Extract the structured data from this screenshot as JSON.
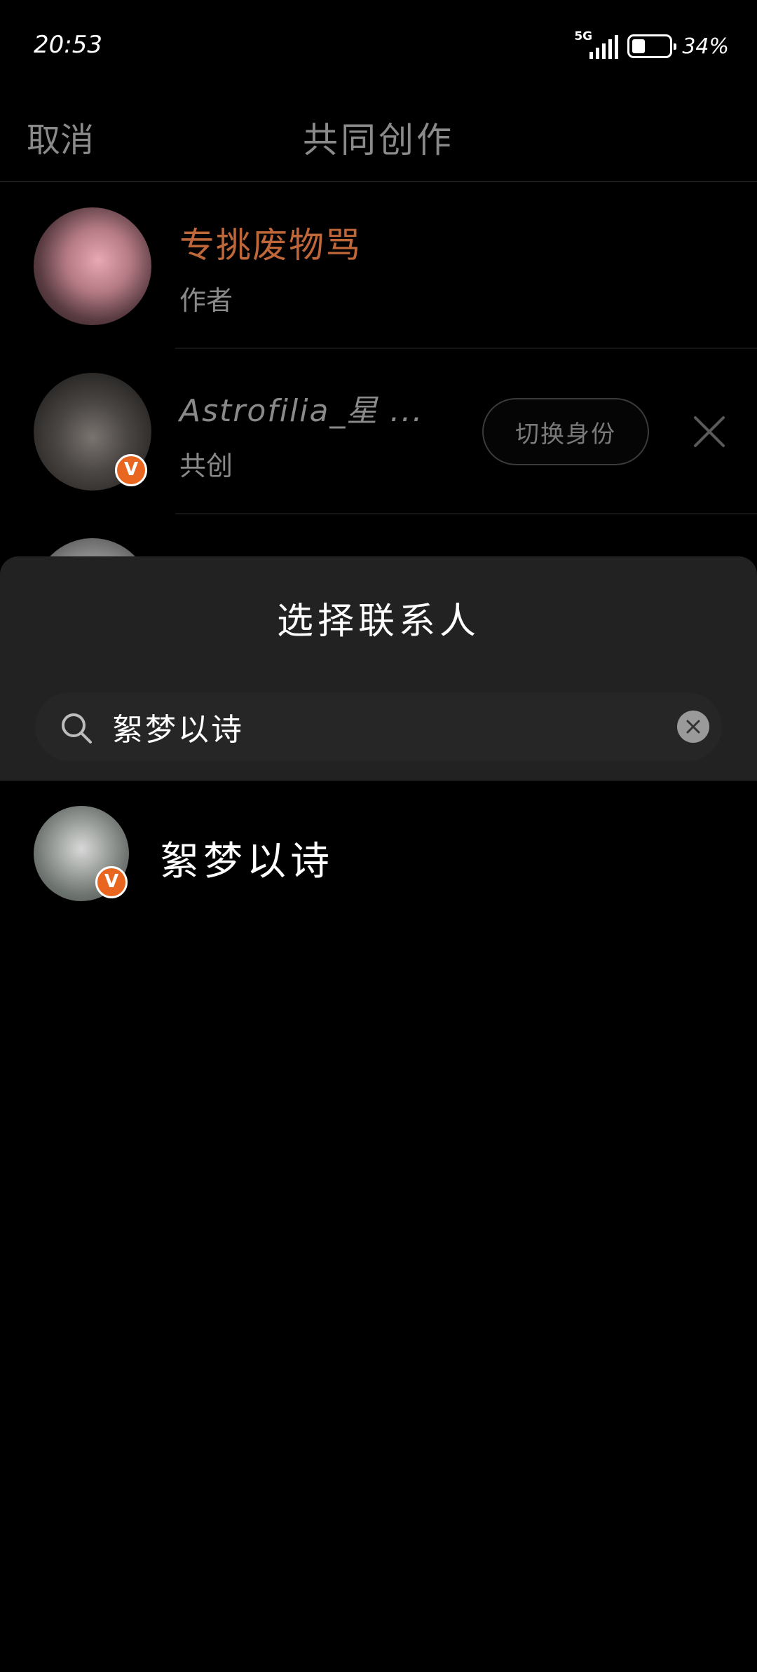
{
  "status_bar": {
    "time": "20:53",
    "network": "5G",
    "battery": "34%",
    "battery_level": 0.34
  },
  "header": {
    "cancel_label": "取消",
    "title": "共同创作"
  },
  "authors": [
    {
      "name": "专挑废物骂",
      "role": "作者",
      "verified": false
    },
    {
      "name": "Astrofilia_星 ...",
      "role": "共创",
      "verified": true,
      "switch_label": "切换身份"
    }
  ],
  "sheet": {
    "title": "选择联系人",
    "search_value": "絮梦以诗"
  },
  "results": [
    {
      "name": "絮梦以诗",
      "verified": true
    }
  ],
  "badge_letter": "V",
  "colors": {
    "author_name": "#c0673a",
    "badge": "#e8661f",
    "sheet_bg": "#222222"
  }
}
